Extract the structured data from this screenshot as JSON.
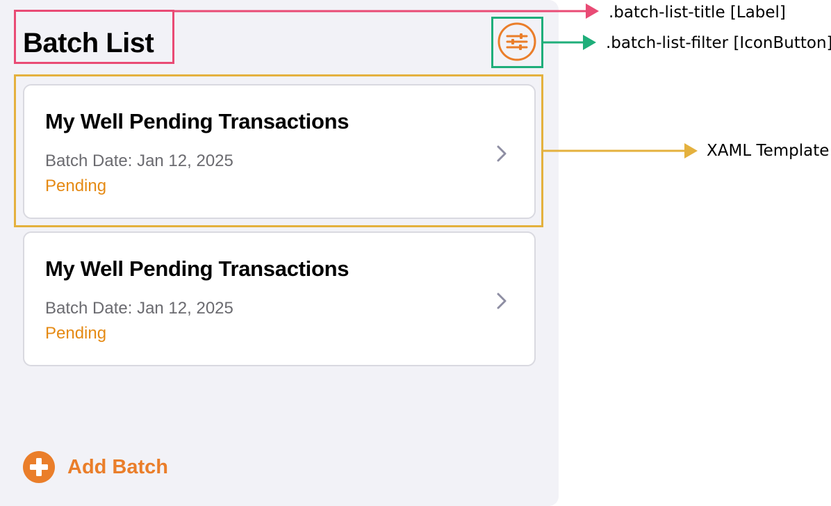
{
  "header": {
    "title": "Batch List",
    "filter_icon": "sliders-icon"
  },
  "batches": [
    {
      "title": "My Well Pending Transactions",
      "date": "Batch Date: Jan 12, 2025",
      "status": "Pending"
    },
    {
      "title": "My Well Pending Transactions",
      "date": "Batch Date: Jan 12, 2025",
      "status": "Pending"
    }
  ],
  "footer": {
    "add_label": "Add Batch",
    "add_icon": "plus-circle-icon"
  },
  "annotations": {
    "title": ".batch-list-title [Label]",
    "filter": ".batch-list-filter [IconButton]",
    "template": "XAML Template"
  },
  "colors": {
    "accent": "#ea7e2a",
    "status_pending": "#e58a14",
    "panel_bg": "#f2f2f7",
    "annotation_title": "#e94b75",
    "annotation_filter": "#1fae7a",
    "annotation_template": "#e4b13e"
  }
}
